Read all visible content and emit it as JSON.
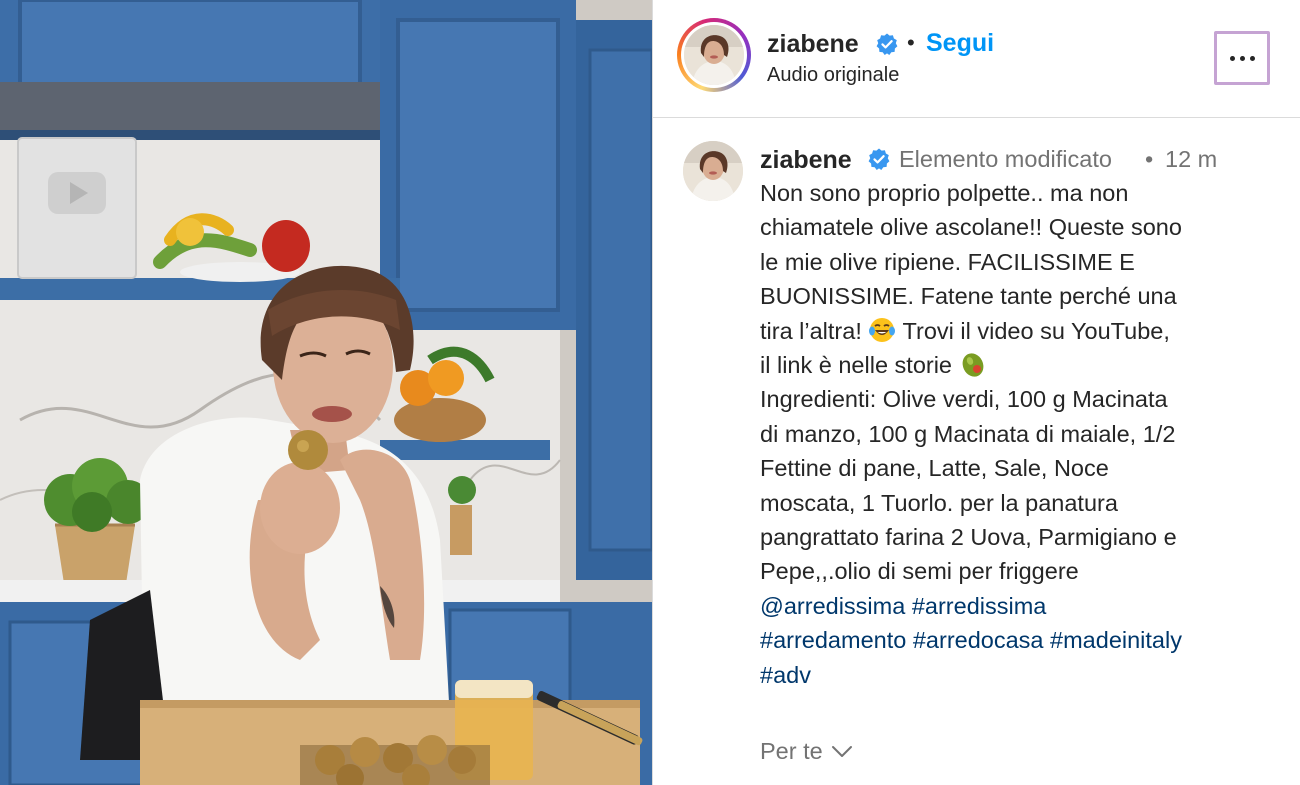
{
  "header": {
    "username": "ziabene",
    "separator": "•",
    "follow_label": "Segui",
    "audio_label": "Audio originale",
    "more_icon": "more-horizontal-icon"
  },
  "caption": {
    "username": "ziabene",
    "edited_label": "Elemento modificato",
    "separator": "•",
    "time": "12 m",
    "text_lines": [
      "Non sono proprio polpette.. ma non",
      "chiamatele olive ascolane!! Queste sono",
      "le mie olive ripiene. FACILISSIME E",
      "BUONISSIME. Fatene tante perché una",
      "tira l’altra!",
      "Trovi il video su YouTube,",
      "il link è nelle storie",
      "Ingredienti: Olive verdi, 100 g Macinata",
      "di manzo, 100 g Macinata di maiale, 1/2",
      "Fettine di pane, Latte, Sale, Noce",
      "moscata, 1 Tuorlo. per la panatura",
      "pangrattato farina 2 Uova, Parmigiano e",
      "Pepe,,.olio di semi per friggere"
    ],
    "emojis": [
      "laughing-tears-emoji",
      "olive-emoji"
    ],
    "mention": "@arredissima",
    "hashtags": [
      "#arredissima",
      "#arredamento",
      "#arredocasa",
      "#madeinitaly",
      "#adv"
    ]
  },
  "footer": {
    "for_you_label": "Per te"
  },
  "colors": {
    "link_blue": "#0095f6",
    "hashtag_blue": "#00376b",
    "muted_gray": "#737373",
    "text": "#262626",
    "cabinet_blue": "#3c6ea6"
  }
}
